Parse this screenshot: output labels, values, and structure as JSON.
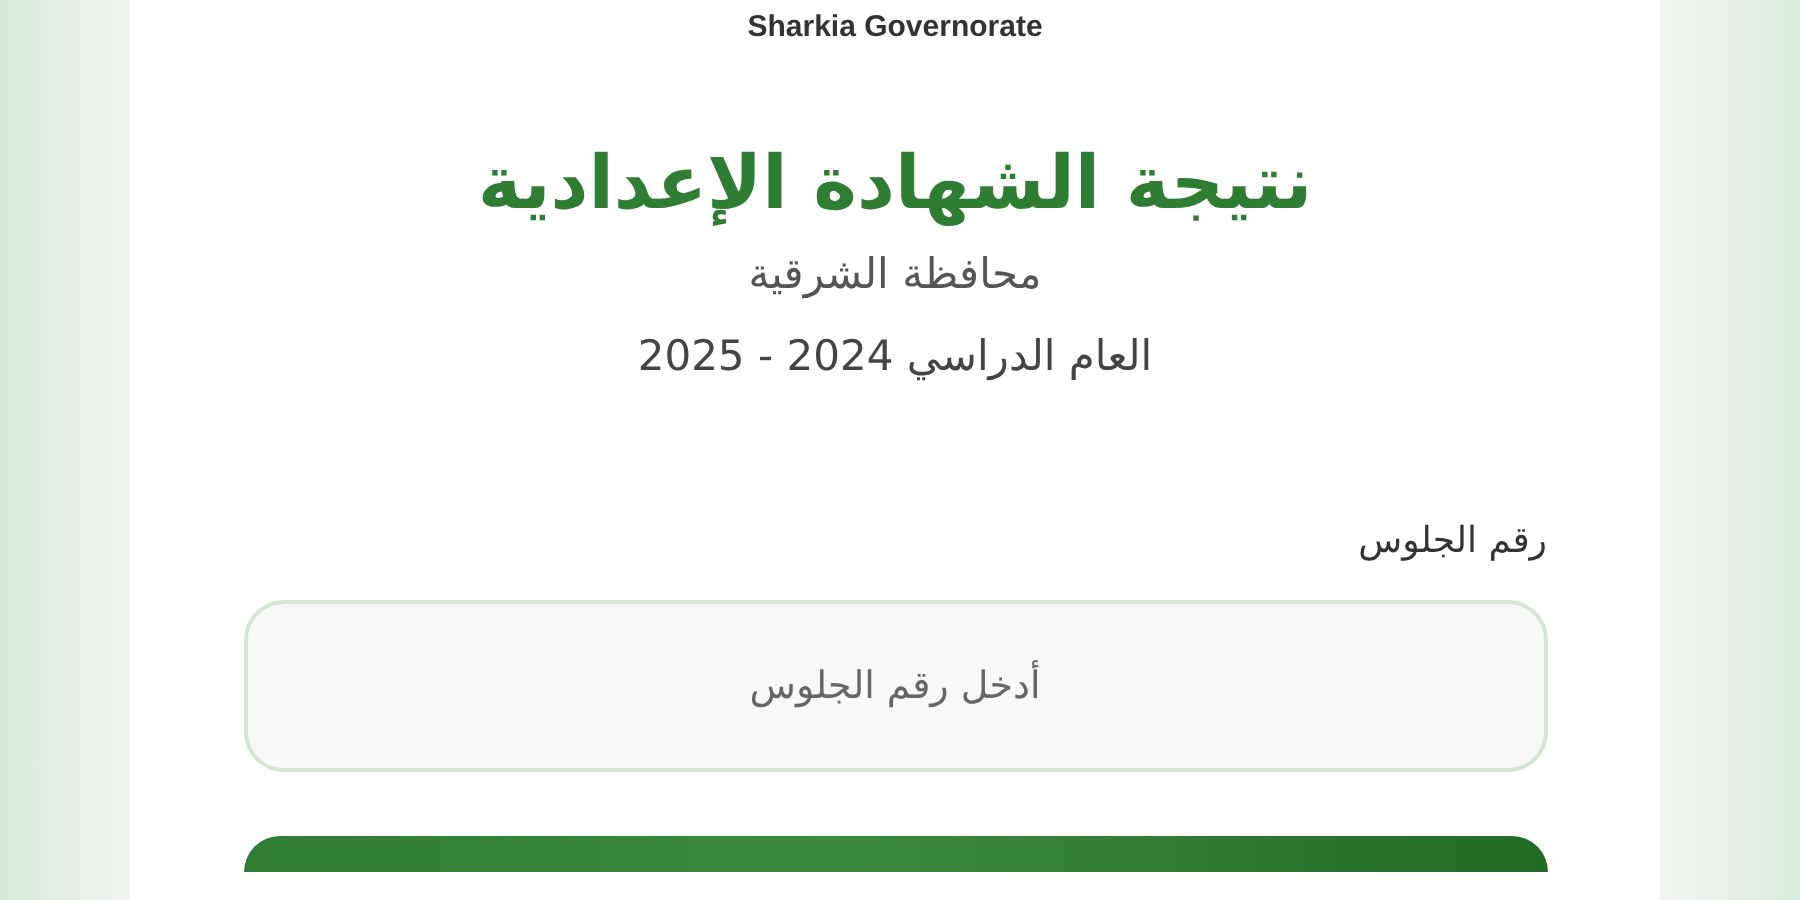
{
  "header": {
    "logo_caption": "Sharkia Governorate"
  },
  "title": "نتيجة الشهادة الإعدادية",
  "subtitle": "محافظة الشرقية",
  "academic_year": "العام الدراسي 2024 - 2025",
  "seat_field": {
    "label": "رقم الجلوس",
    "placeholder": "أدخل رقم الجلوس"
  }
}
